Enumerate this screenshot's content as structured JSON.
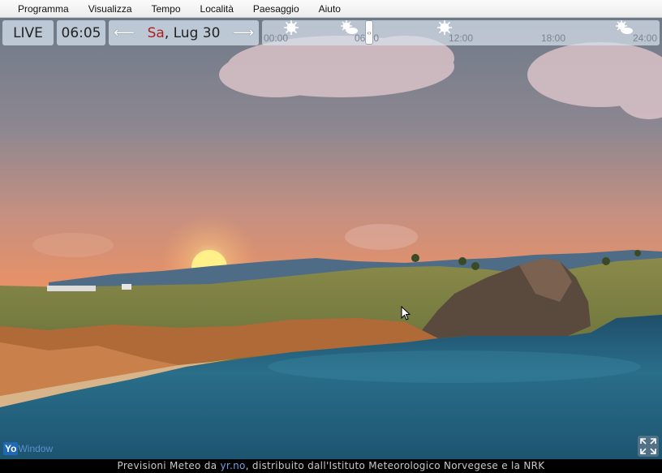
{
  "menu": [
    "Programma",
    "Visualizza",
    "Tempo",
    "Località",
    "Paesaggio",
    "Aiuto"
  ],
  "toolbar": {
    "live_label": "LIVE",
    "time": "06:05",
    "prev_arrow": "⟵",
    "next_arrow": "⟶",
    "day": "Sa",
    "date_rest": ", Lug 30"
  },
  "timeline": {
    "ticks": [
      "00:00",
      "06:00",
      "12:00",
      "18:00",
      "24:00"
    ],
    "icons": [
      "sun-icon",
      "partly-cloudy-icon",
      "sun-icon",
      "partly-cloudy-icon"
    ],
    "slider_glyph": "‹›"
  },
  "footer": {
    "prefix": "Previsioni Meteo da ",
    "link": "yr.no",
    "suffix": ", distribuito dall'Istituto Meteorologico Norvegese e la NRK"
  },
  "logo": {
    "yo": "Yo",
    "window": "Window"
  },
  "colors": {
    "toolbar_bg": "#d2deea",
    "day_red": "#b02020",
    "footer_link": "#6fa0e0"
  }
}
